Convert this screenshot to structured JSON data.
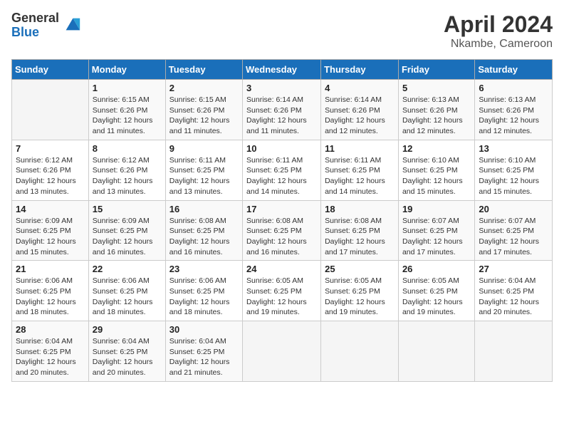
{
  "logo": {
    "general": "General",
    "blue": "Blue"
  },
  "title": "April 2024",
  "subtitle": "Nkambe, Cameroon",
  "days_header": [
    "Sunday",
    "Monday",
    "Tuesday",
    "Wednesday",
    "Thursday",
    "Friday",
    "Saturday"
  ],
  "weeks": [
    [
      {
        "day": "",
        "info": ""
      },
      {
        "day": "1",
        "info": "Sunrise: 6:15 AM\nSunset: 6:26 PM\nDaylight: 12 hours\nand 11 minutes."
      },
      {
        "day": "2",
        "info": "Sunrise: 6:15 AM\nSunset: 6:26 PM\nDaylight: 12 hours\nand 11 minutes."
      },
      {
        "day": "3",
        "info": "Sunrise: 6:14 AM\nSunset: 6:26 PM\nDaylight: 12 hours\nand 11 minutes."
      },
      {
        "day": "4",
        "info": "Sunrise: 6:14 AM\nSunset: 6:26 PM\nDaylight: 12 hours\nand 12 minutes."
      },
      {
        "day": "5",
        "info": "Sunrise: 6:13 AM\nSunset: 6:26 PM\nDaylight: 12 hours\nand 12 minutes."
      },
      {
        "day": "6",
        "info": "Sunrise: 6:13 AM\nSunset: 6:26 PM\nDaylight: 12 hours\nand 12 minutes."
      }
    ],
    [
      {
        "day": "7",
        "info": "Sunrise: 6:12 AM\nSunset: 6:26 PM\nDaylight: 12 hours\nand 13 minutes."
      },
      {
        "day": "8",
        "info": "Sunrise: 6:12 AM\nSunset: 6:26 PM\nDaylight: 12 hours\nand 13 minutes."
      },
      {
        "day": "9",
        "info": "Sunrise: 6:11 AM\nSunset: 6:25 PM\nDaylight: 12 hours\nand 13 minutes."
      },
      {
        "day": "10",
        "info": "Sunrise: 6:11 AM\nSunset: 6:25 PM\nDaylight: 12 hours\nand 14 minutes."
      },
      {
        "day": "11",
        "info": "Sunrise: 6:11 AM\nSunset: 6:25 PM\nDaylight: 12 hours\nand 14 minutes."
      },
      {
        "day": "12",
        "info": "Sunrise: 6:10 AM\nSunset: 6:25 PM\nDaylight: 12 hours\nand 15 minutes."
      },
      {
        "day": "13",
        "info": "Sunrise: 6:10 AM\nSunset: 6:25 PM\nDaylight: 12 hours\nand 15 minutes."
      }
    ],
    [
      {
        "day": "14",
        "info": "Sunrise: 6:09 AM\nSunset: 6:25 PM\nDaylight: 12 hours\nand 15 minutes."
      },
      {
        "day": "15",
        "info": "Sunrise: 6:09 AM\nSunset: 6:25 PM\nDaylight: 12 hours\nand 16 minutes."
      },
      {
        "day": "16",
        "info": "Sunrise: 6:08 AM\nSunset: 6:25 PM\nDaylight: 12 hours\nand 16 minutes."
      },
      {
        "day": "17",
        "info": "Sunrise: 6:08 AM\nSunset: 6:25 PM\nDaylight: 12 hours\nand 16 minutes."
      },
      {
        "day": "18",
        "info": "Sunrise: 6:08 AM\nSunset: 6:25 PM\nDaylight: 12 hours\nand 17 minutes."
      },
      {
        "day": "19",
        "info": "Sunrise: 6:07 AM\nSunset: 6:25 PM\nDaylight: 12 hours\nand 17 minutes."
      },
      {
        "day": "20",
        "info": "Sunrise: 6:07 AM\nSunset: 6:25 PM\nDaylight: 12 hours\nand 17 minutes."
      }
    ],
    [
      {
        "day": "21",
        "info": "Sunrise: 6:06 AM\nSunset: 6:25 PM\nDaylight: 12 hours\nand 18 minutes."
      },
      {
        "day": "22",
        "info": "Sunrise: 6:06 AM\nSunset: 6:25 PM\nDaylight: 12 hours\nand 18 minutes."
      },
      {
        "day": "23",
        "info": "Sunrise: 6:06 AM\nSunset: 6:25 PM\nDaylight: 12 hours\nand 18 minutes."
      },
      {
        "day": "24",
        "info": "Sunrise: 6:05 AM\nSunset: 6:25 PM\nDaylight: 12 hours\nand 19 minutes."
      },
      {
        "day": "25",
        "info": "Sunrise: 6:05 AM\nSunset: 6:25 PM\nDaylight: 12 hours\nand 19 minutes."
      },
      {
        "day": "26",
        "info": "Sunrise: 6:05 AM\nSunset: 6:25 PM\nDaylight: 12 hours\nand 19 minutes."
      },
      {
        "day": "27",
        "info": "Sunrise: 6:04 AM\nSunset: 6:25 PM\nDaylight: 12 hours\nand 20 minutes."
      }
    ],
    [
      {
        "day": "28",
        "info": "Sunrise: 6:04 AM\nSunset: 6:25 PM\nDaylight: 12 hours\nand 20 minutes."
      },
      {
        "day": "29",
        "info": "Sunrise: 6:04 AM\nSunset: 6:25 PM\nDaylight: 12 hours\nand 20 minutes."
      },
      {
        "day": "30",
        "info": "Sunrise: 6:04 AM\nSunset: 6:25 PM\nDaylight: 12 hours\nand 21 minutes."
      },
      {
        "day": "",
        "info": ""
      },
      {
        "day": "",
        "info": ""
      },
      {
        "day": "",
        "info": ""
      },
      {
        "day": "",
        "info": ""
      }
    ]
  ]
}
